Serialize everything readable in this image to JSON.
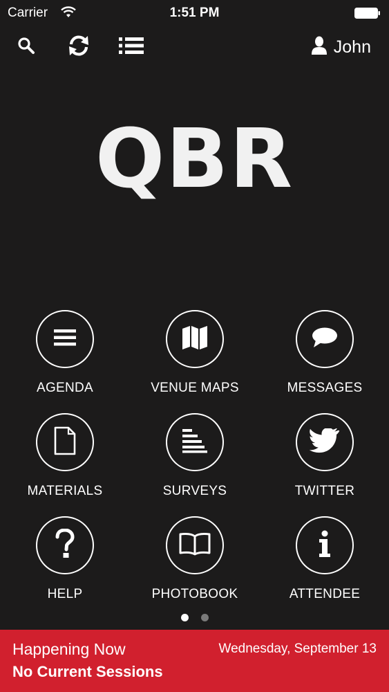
{
  "status_bar": {
    "carrier": "Carrier",
    "time": "1:51 PM"
  },
  "toolbar": {
    "icons": [
      "search-icon",
      "refresh-icon",
      "list-icon"
    ],
    "user_name": "John"
  },
  "logo_text": "QBR",
  "tiles": [
    {
      "label": "AGENDA",
      "icon": "agenda-list-icon"
    },
    {
      "label": "VENUE MAPS",
      "icon": "map-icon"
    },
    {
      "label": "MESSAGES",
      "icon": "chat-bubble-icon"
    },
    {
      "label": "MATERIALS",
      "icon": "document-icon"
    },
    {
      "label": "SURVEYS",
      "icon": "survey-icon"
    },
    {
      "label": "TWITTER",
      "icon": "twitter-bird-icon"
    },
    {
      "label": "HELP",
      "icon": "question-icon"
    },
    {
      "label": "PHOTOBOOK",
      "icon": "book-icon"
    },
    {
      "label": "ATTENDEE",
      "icon": "info-person-icon"
    }
  ],
  "pager": {
    "pages": 2,
    "active_page": 1
  },
  "footer": {
    "heading": "Happening Now",
    "date": "Wednesday, September 13",
    "subtext": "No Current Sessions"
  },
  "colors": {
    "background": "#1c1b1b",
    "accent": "#d1202e",
    "foreground": "#ffffff"
  }
}
